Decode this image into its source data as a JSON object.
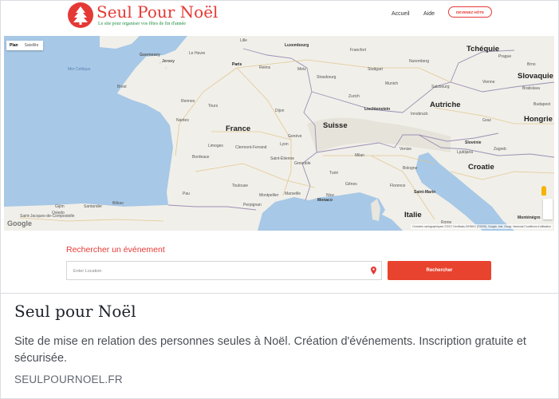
{
  "site_header": {
    "logo_title": "Seul Pour Noël",
    "logo_tagline": "Le site pour organiser vos fêtes de fin d'année",
    "nav": [
      "Accueil",
      "Aide"
    ],
    "host_button": "DEVENEZ HÔTE",
    "brand_color": "#e53935"
  },
  "map": {
    "type_control": [
      "Plan",
      "Satellite"
    ],
    "selected_type": "Plan",
    "countries": [
      "France",
      "Suisse",
      "Italie",
      "Autriche",
      "Tchéquie",
      "Slovaquie",
      "Hongrie",
      "Slovénie",
      "Croatie",
      "Liechtenstein",
      "Luxembourg",
      "Monaco",
      "Saint-Marin",
      "Monténégro"
    ],
    "cities": [
      "Paris",
      "Guernesey",
      "Jersey",
      "Strasbourg",
      "Zurich",
      "Munich",
      "Vienne",
      "Lyon",
      "Bordeaux",
      "Marseille",
      "Nantes",
      "Rennes",
      "Toulouse",
      "Milan",
      "Turin",
      "Venise",
      "Florence",
      "Rome",
      "Genève",
      "Prague",
      "Brno",
      "Zagreb",
      "Ljubljana",
      "Graz",
      "Bratislava",
      "Budapest",
      "Stuttgart",
      "Francfort",
      "Nuremberg",
      "Salzbourg",
      "Innsbruck",
      "Bologne",
      "Gênes",
      "Nice",
      "Montpellier",
      "Limoges",
      "Clermont-Ferrand",
      "Dijon",
      "Tours",
      "Brest",
      "Le Havre",
      "Lille",
      "Reims",
      "Metz",
      "Saint-Étienne",
      "Grenoble",
      "Perpignan",
      "Pau",
      "Bilbao",
      "Santander",
      "Oviedo",
      "Saint-Jacques-de-Compostelle",
      "Gijón"
    ],
    "seas": [
      "Mer Celtique"
    ],
    "google_mark": "Google",
    "credit": "Données cartographiques ©2017 GeoBasis-DE/BKG (©2009), Google, Inst. Geogr. Nacional   Conditions d'utilisation"
  },
  "search": {
    "title": "Rechercher un événement",
    "location_placeholder": "Enter Location",
    "location_value": "",
    "button": "Rechercher"
  },
  "caption": {
    "title": "Seul pour Noël",
    "description": "Site de mise en relation des personnes seules à Noël. Création d'événements. Inscription gratuite et sécurisée.",
    "domain": "SEULPOURNOEL.FR"
  },
  "colors": {
    "accent": "#e53935",
    "sea": "#a7c8e6",
    "land": "#f1efe9",
    "tagline": "#1e8e3e"
  }
}
